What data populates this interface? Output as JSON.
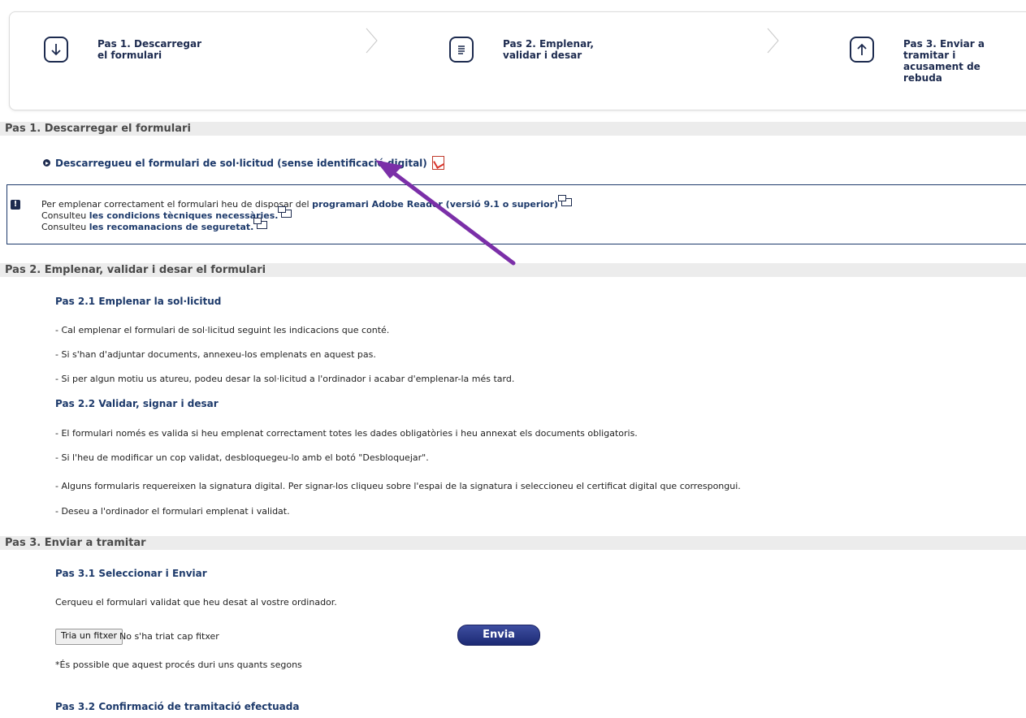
{
  "steps": [
    {
      "label": "Pas 1. Descarregar el formulari",
      "icon": "download-icon"
    },
    {
      "label": "Pas 2. Emplenar, validar i desar",
      "icon": "document-icon"
    },
    {
      "label": "Pas 3. Enviar a tramitar i acusament de rebuda",
      "icon": "upload-icon"
    }
  ],
  "section1": {
    "title": "Pas 1. Descarregar el formulari",
    "download_link": "Descarregueu el formulari de sol·licitud (sense identificació digital)"
  },
  "notice": {
    "line1_prefix": "Per emplenar correctament el formulari heu de disposar del ",
    "line1_link": "programari Adobe Reader (versió 9.1 o superior)",
    "line2_prefix": "Consulteu ",
    "line2_link": "les condicions tècniques necessàries.",
    "line3_prefix": "Consulteu ",
    "line3_link": "les recomanacions de seguretat."
  },
  "section2": {
    "title": "Pas 2. Emplenar, validar i desar el formulari",
    "sub1_title": "Pas 2.1 Emplenar la sol·licitud",
    "sub1_items": [
      "- Cal emplenar el formulari de sol·licitud seguint les indicacions que conté.",
      "- Si s'han d'adjuntar documents, annexeu-los emplenats en aquest pas.",
      "- Si per algun motiu us atureu, podeu desar la sol·licitud a l'ordinador i acabar d'emplenar-la més tard."
    ],
    "sub2_title": "Pas 2.2 Validar, signar i desar",
    "sub2_items": [
      "- El formulari només es valida si heu emplenat correctament totes les dades obligatòries i heu annexat els documents obligatoris.",
      "- Si l'heu de modificar un cop validat, desbloquegeu-lo amb el botó \"Desbloquejar\".",
      "- Alguns formularis requereixen la signatura digital. Per signar-los cliqueu sobre l'espai de la signatura i seleccioneu el certificat digital que correspongui.",
      "- Deseu a l'ordinador el formulari emplenat i validat."
    ]
  },
  "section3": {
    "title": "Pas 3. Enviar a tramitar",
    "sub1_title": "Pas 3.1 Seleccionar i Enviar",
    "search_text": "Cerqueu el formulari validat que heu desat al vostre ordinador.",
    "file_button": "Tria un fitxer",
    "file_status": "No s'ha triat cap fitxer",
    "send_button": "Envia",
    "note": "*És possible que aquest procés duri uns quants segons",
    "sub2_title": "Pas 3.2 Confirmació de tramitació efectuada"
  },
  "colors": {
    "arrow": "#7b2fa8",
    "header_bg": "#ececec",
    "accent": "#1d3a6b"
  }
}
